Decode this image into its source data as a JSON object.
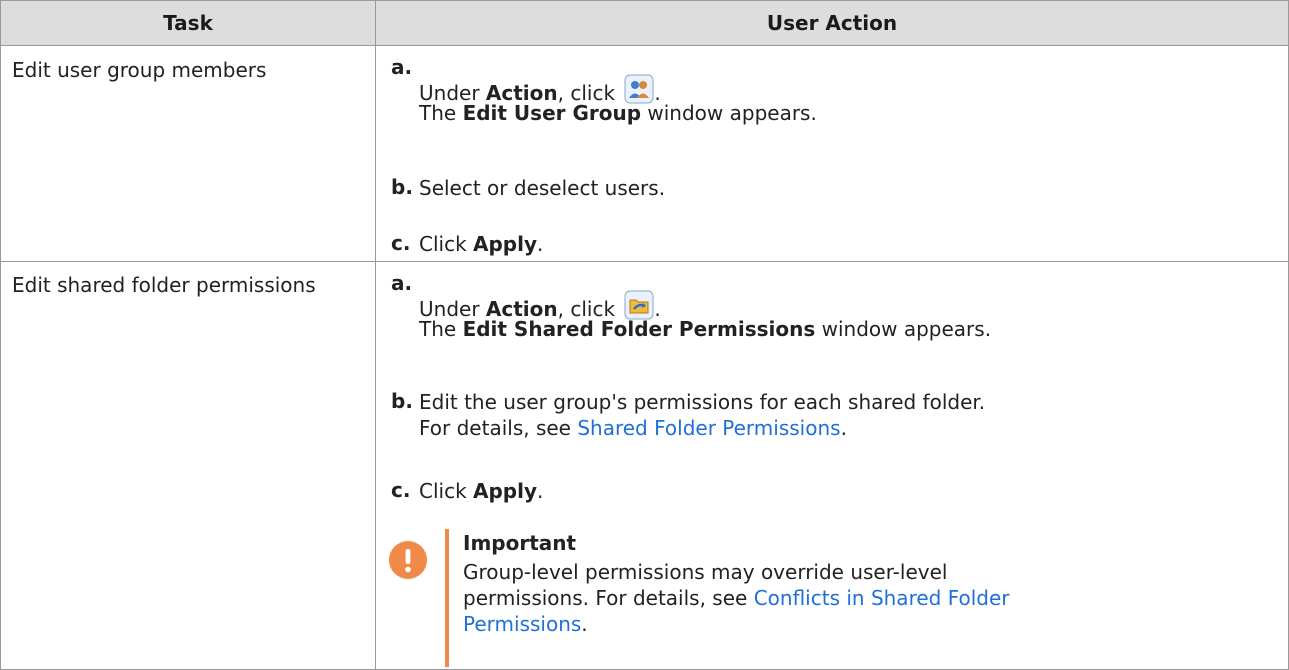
{
  "header": {
    "task": "Task",
    "user_action": "User Action"
  },
  "rows": [
    {
      "task": "Edit user group members",
      "steps": {
        "a": {
          "letter": "a.",
          "line1_pre": "Under ",
          "line1_bold": "Action",
          "line1_post": ", click",
          "line1_end": ".",
          "line2_pre": "The ",
          "line2_bold": "Edit User Group",
          "line2_post": " window appears."
        },
        "b": {
          "letter": "b.",
          "text": "Select or deselect users."
        },
        "c": {
          "letter": "c.",
          "pre": "Click ",
          "bold": "Apply",
          "post": "."
        }
      },
      "icon": "edit-user-group-icon"
    },
    {
      "task": "Edit shared folder permissions",
      "steps": {
        "a": {
          "letter": "a.",
          "line1_pre": "Under ",
          "line1_bold": "Action",
          "line1_post": ", click",
          "line1_end": ".",
          "line2_pre": "The ",
          "line2_bold": "Edit Shared Folder Permissions",
          "line2_post": " window appears."
        },
        "b": {
          "letter": "b.",
          "text": "Edit the user group's permissions for each shared folder.",
          "details_pre": "For details, see ",
          "details_link": "Shared Folder Permissions",
          "details_post": "."
        },
        "c": {
          "letter": "c.",
          "pre": "Click ",
          "bold": "Apply",
          "post": "."
        }
      },
      "icon": "edit-shared-folder-icon",
      "note": {
        "icon": "important-icon",
        "title": "Important",
        "line1": "Group-level permissions may override user-level",
        "line2_pre": "permissions. For details, see ",
        "line2_link": "Conflicts in Shared Folder",
        "line3_link": "Permissions",
        "line3_post": ".",
        "accent_color": "#f08a4b"
      }
    }
  ],
  "colors": {
    "header_bg": "#dddddd",
    "border": "#9a9a9a",
    "link": "#1f6fd6"
  }
}
